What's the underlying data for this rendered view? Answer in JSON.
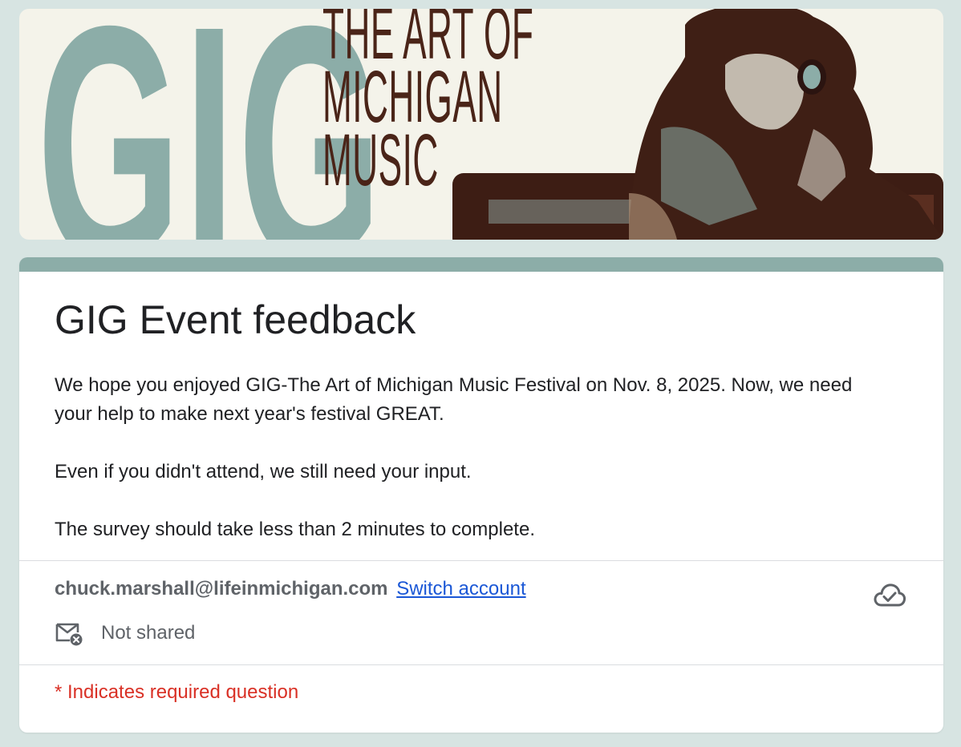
{
  "banner": {
    "logo_letters": "GIG",
    "title_lines": [
      "THE ART OF",
      "MICHIGAN",
      "MUSIC"
    ],
    "accent_color": "#8cada8",
    "ink_color": "#4a2418"
  },
  "form": {
    "title": "GIG Event feedback",
    "description": [
      "We hope you enjoyed GIG-The Art of Michigan Music Festival on Nov. 8, 2025. Now, we need your help to make next year's festival GREAT.",
      "Even if you didn't attend, we still need your input.",
      "The survey should take less than 2 minutes to complete."
    ],
    "account_email": "chuck.marshall@lifeinmichigan.com",
    "switch_account_label": "Switch account",
    "share_status": "Not shared",
    "required_note": "* Indicates required question",
    "icons": {
      "saved_state": "cloud-check-icon",
      "email_not_shared": "mail-off-icon"
    }
  }
}
